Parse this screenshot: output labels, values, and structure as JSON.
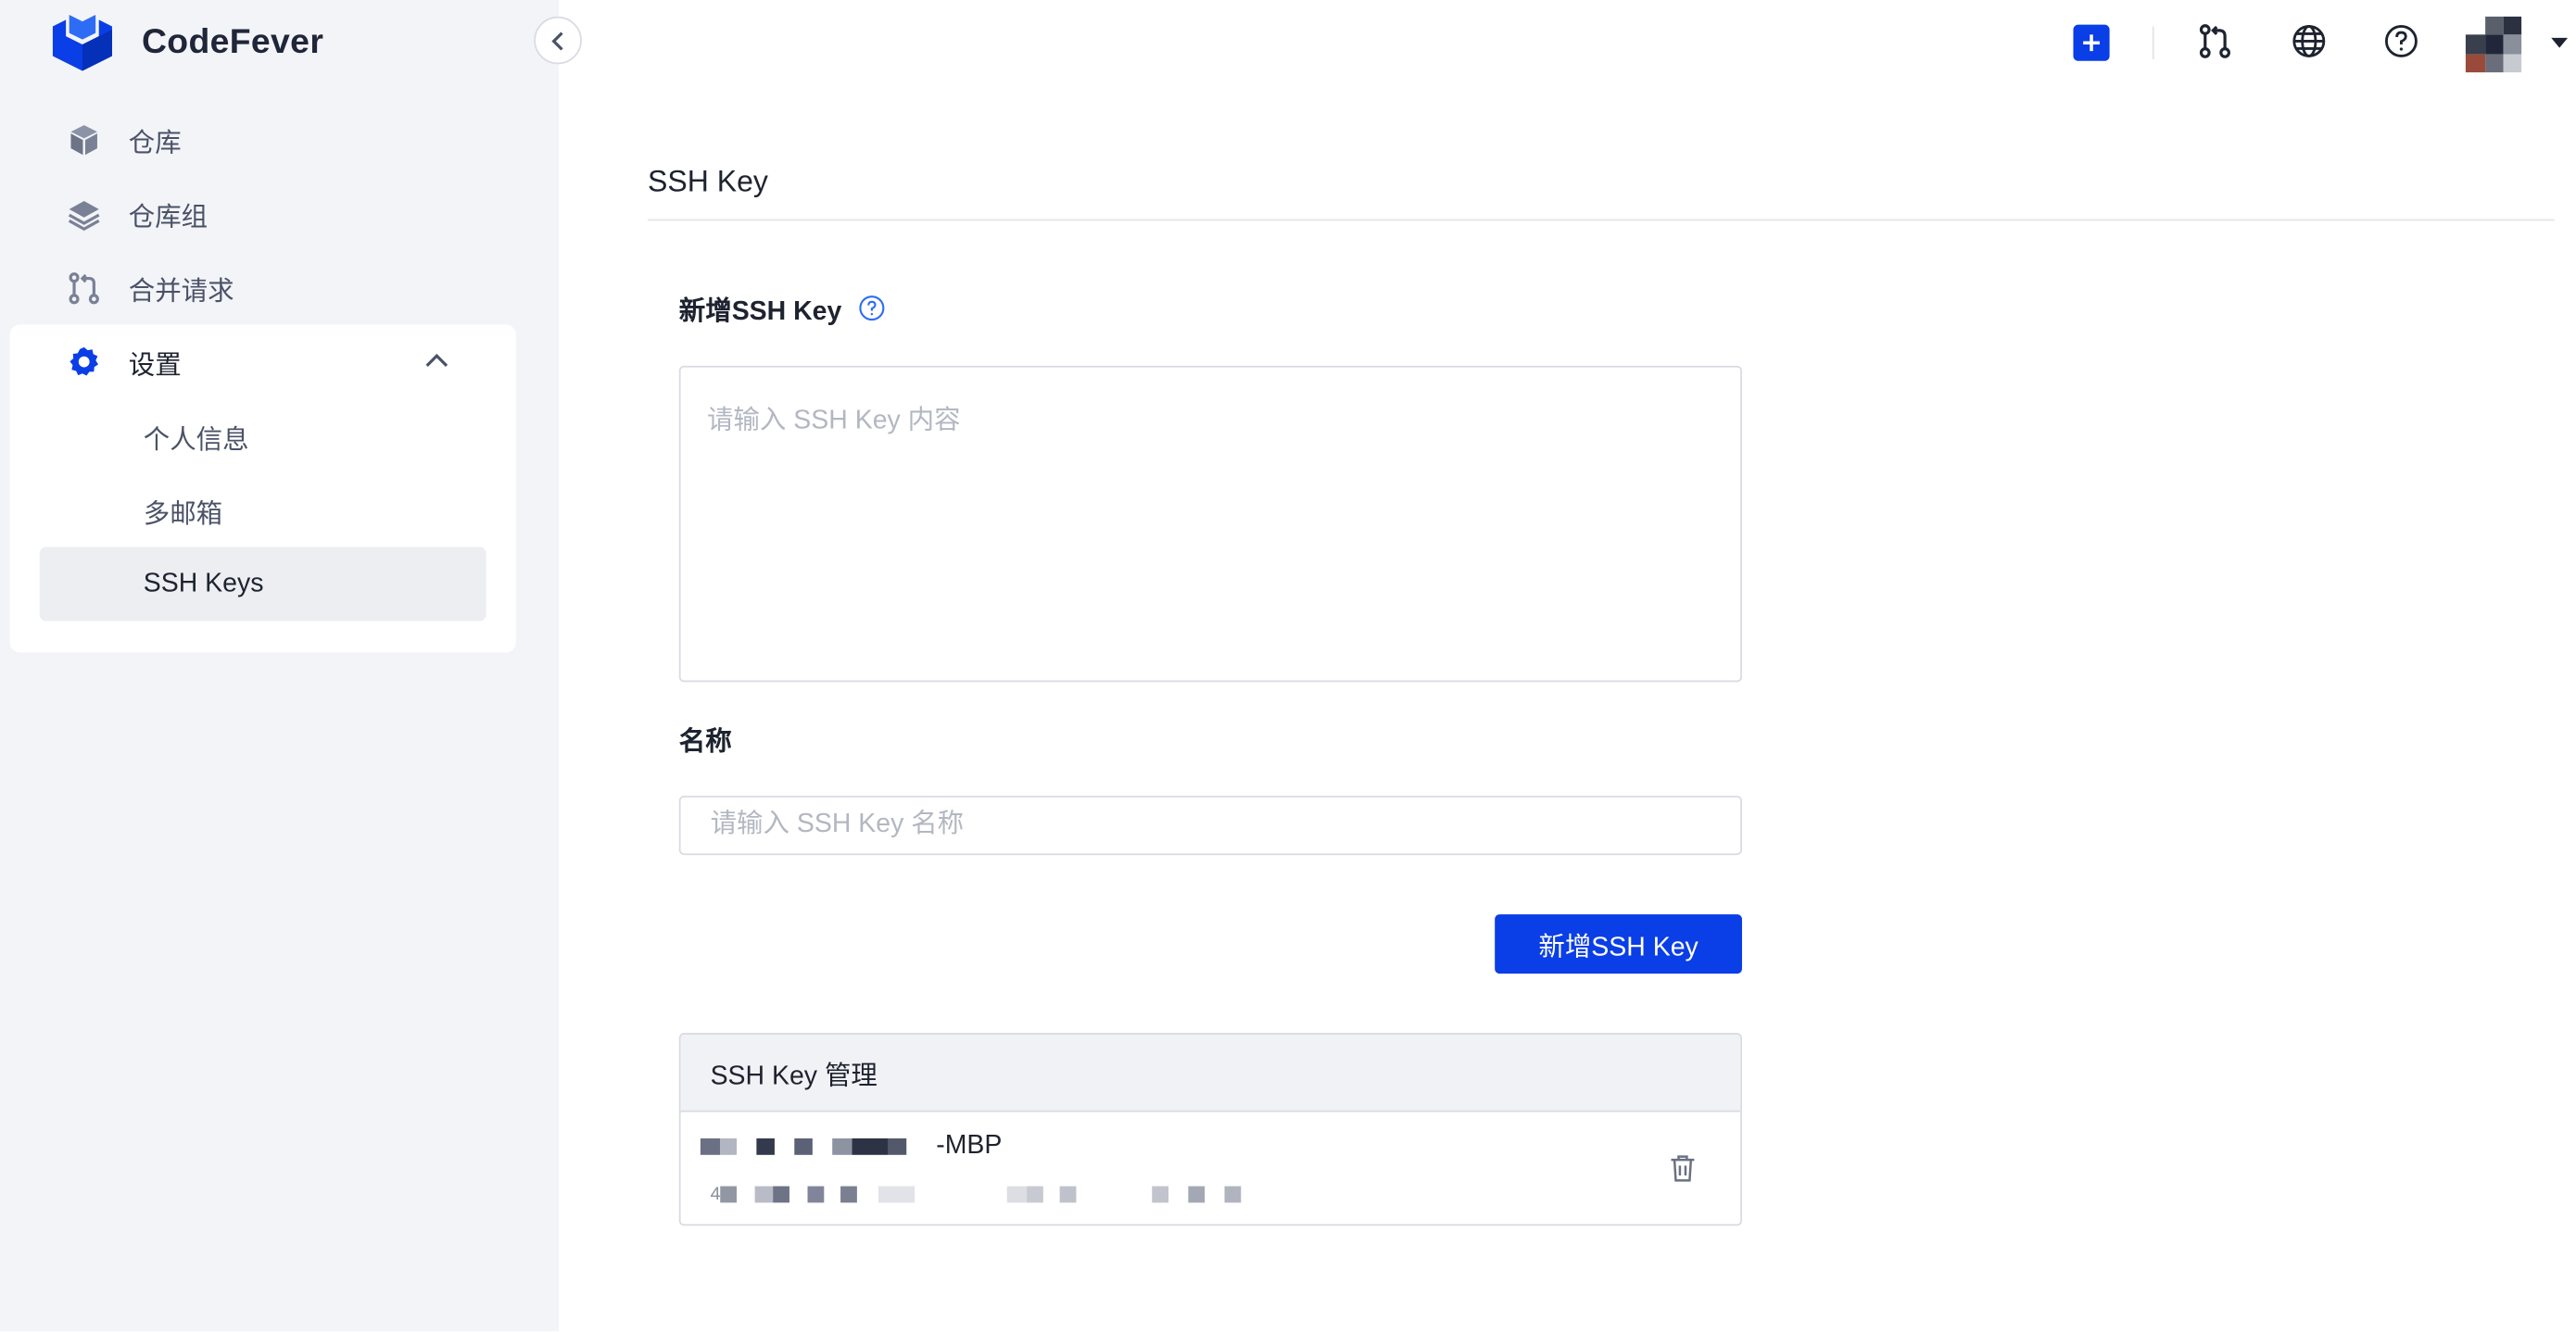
{
  "app": {
    "name": "CodeFever"
  },
  "sidebar": {
    "items": [
      {
        "label": "仓库",
        "icon": "cube-icon"
      },
      {
        "label": "仓库组",
        "icon": "layers-icon"
      },
      {
        "label": "合并请求",
        "icon": "merge-request-icon"
      }
    ],
    "settings": {
      "label": "设置",
      "icon": "gear-icon",
      "expanded": true,
      "sub_items": [
        {
          "label": "个人信息",
          "active": false
        },
        {
          "label": "多邮箱",
          "active": false
        },
        {
          "label": "SSH Keys",
          "active": true
        }
      ]
    }
  },
  "topbar": {
    "icons": [
      "plus-icon",
      "merge-request-icon",
      "globe-icon",
      "help-icon",
      "avatar",
      "caret-down-icon"
    ]
  },
  "page": {
    "title": "SSH Key",
    "add_section": {
      "label": "新增SSH Key",
      "key_placeholder": "请输入 SSH Key 内容",
      "name_label": "名称",
      "name_placeholder": "请输入 SSH Key 名称",
      "submit_label": "新增SSH Key"
    },
    "manage": {
      "header": "SSH Key 管理",
      "keys": [
        {
          "title_suffix": "-MBP",
          "fingerprint_prefix": "4"
        }
      ]
    }
  },
  "colors": {
    "brand_blue": "#0a3ee6",
    "sidebar_bg": "#f3f4f7",
    "text_primary": "#1e2330",
    "text_secondary": "#4a5268"
  }
}
